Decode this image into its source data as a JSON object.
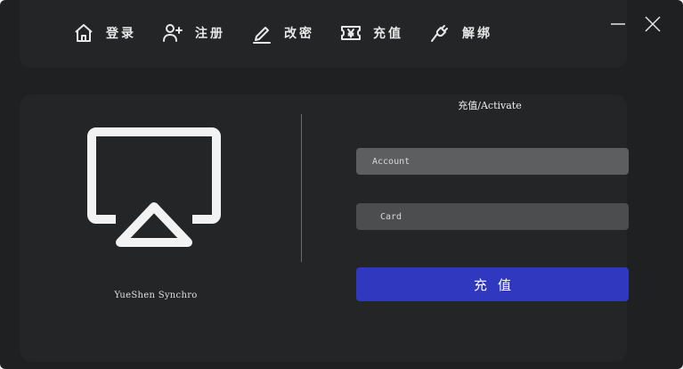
{
  "nav": {
    "items": [
      {
        "label": "登录",
        "icon": "home-icon"
      },
      {
        "label": "注册",
        "icon": "add-user-icon"
      },
      {
        "label": "改密",
        "icon": "pen-icon"
      },
      {
        "label": "充值",
        "icon": "yen-ticket-icon"
      },
      {
        "label": "解绑",
        "icon": "unplug-icon"
      }
    ]
  },
  "window": {
    "minimize_icon": "minimize-icon",
    "close_icon": "close-icon"
  },
  "brand": {
    "logo_icon": "airplay-icon",
    "name": "YueShen Synchro"
  },
  "form": {
    "title": "充值/Activate",
    "account_placeholder": "Account",
    "card_placeholder": "Card",
    "submit_label": "充值"
  },
  "colors": {
    "background": "#1f2021",
    "field": "#5d5e5f",
    "accent": "#3038c0",
    "text": "#e8e8e8"
  }
}
